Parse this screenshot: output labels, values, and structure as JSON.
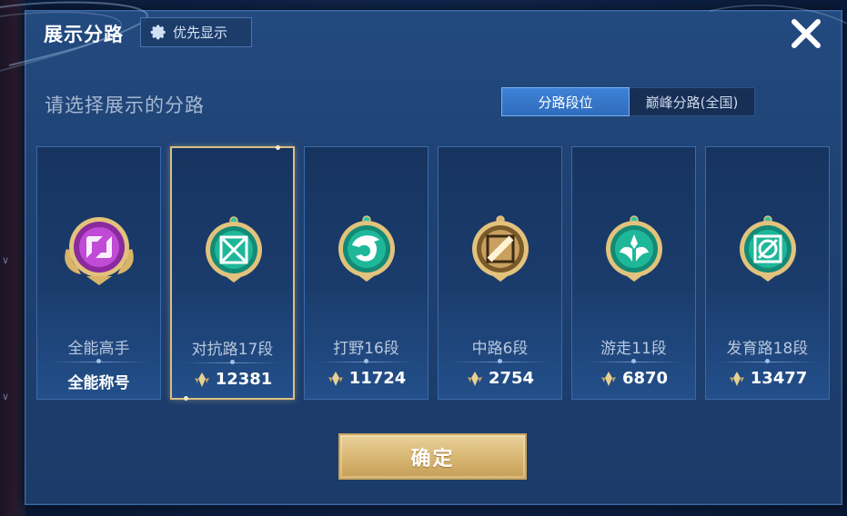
{
  "dialog": {
    "title": "展示分路",
    "priority_button": "优先显示",
    "subtitle": "请选择展示的分路",
    "confirm_button": "确定"
  },
  "tabs": [
    {
      "label": "分路段位",
      "active": true
    },
    {
      "label": "巅峰分路(全国)",
      "active": false
    }
  ],
  "lanes": [
    {
      "name": "全能高手",
      "value": "全能称号",
      "emblem": "all-round-emblem-icon",
      "color": "#c04bd6",
      "selected": false,
      "is_title": true
    },
    {
      "name": "对抗路17段",
      "value": "12381",
      "emblem": "clash-lane-emblem-icon",
      "color": "#1fb79a",
      "selected": true,
      "is_title": false
    },
    {
      "name": "打野16段",
      "value": "11724",
      "emblem": "jungle-emblem-icon",
      "color": "#1fb79a",
      "selected": false,
      "is_title": false
    },
    {
      "name": "中路6段",
      "value": "2754",
      "emblem": "mid-lane-emblem-icon",
      "color": "#c9a060",
      "selected": false,
      "is_title": false
    },
    {
      "name": "游走11段",
      "value": "6870",
      "emblem": "roam-emblem-icon",
      "color": "#1fb79a",
      "selected": false,
      "is_title": false
    },
    {
      "name": "发育路18段",
      "value": "13477",
      "emblem": "farm-lane-emblem-icon",
      "color": "#1fb79a",
      "selected": false,
      "is_title": false
    }
  ],
  "colors": {
    "panel": "#1f4274",
    "tab_active": "#3f82d6",
    "gold": "#d9b774",
    "selected_border": "#d9bf82"
  }
}
